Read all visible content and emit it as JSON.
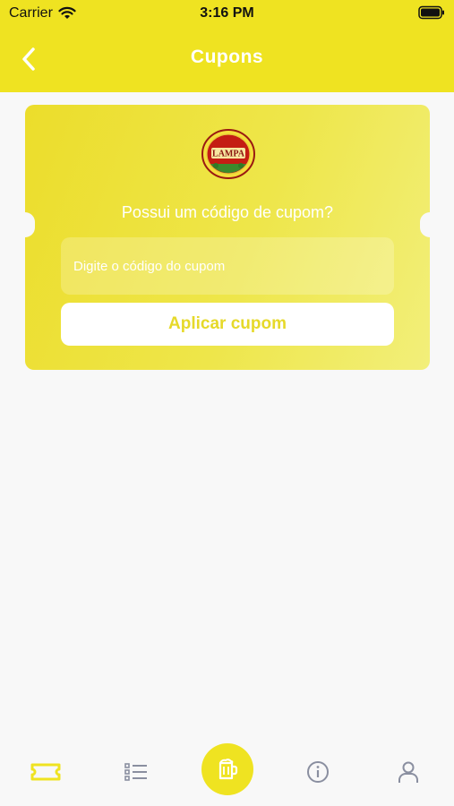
{
  "status_bar": {
    "carrier": "Carrier",
    "time": "3:16 PM"
  },
  "header": {
    "title": "Cupons",
    "back_icon": "chevron-left-icon"
  },
  "coupon": {
    "logo_name": "lampa-logo",
    "logo_text": "LAMPA",
    "prompt": "Possui um código de cupom?",
    "input_placeholder": "Digite o código do cupom",
    "input_value": "",
    "apply_label": "Aplicar cupom"
  },
  "tab_bar": {
    "items": [
      {
        "icon": "ticket-icon",
        "active": true
      },
      {
        "icon": "list-icon",
        "active": false
      },
      {
        "icon": "beer-mug-icon",
        "active": false
      },
      {
        "icon": "info-icon",
        "active": false
      },
      {
        "icon": "user-icon",
        "active": false
      }
    ]
  },
  "colors": {
    "brand": "#efe321",
    "background": "#f8f8f8",
    "inactive_icon": "#8a8fa0"
  }
}
